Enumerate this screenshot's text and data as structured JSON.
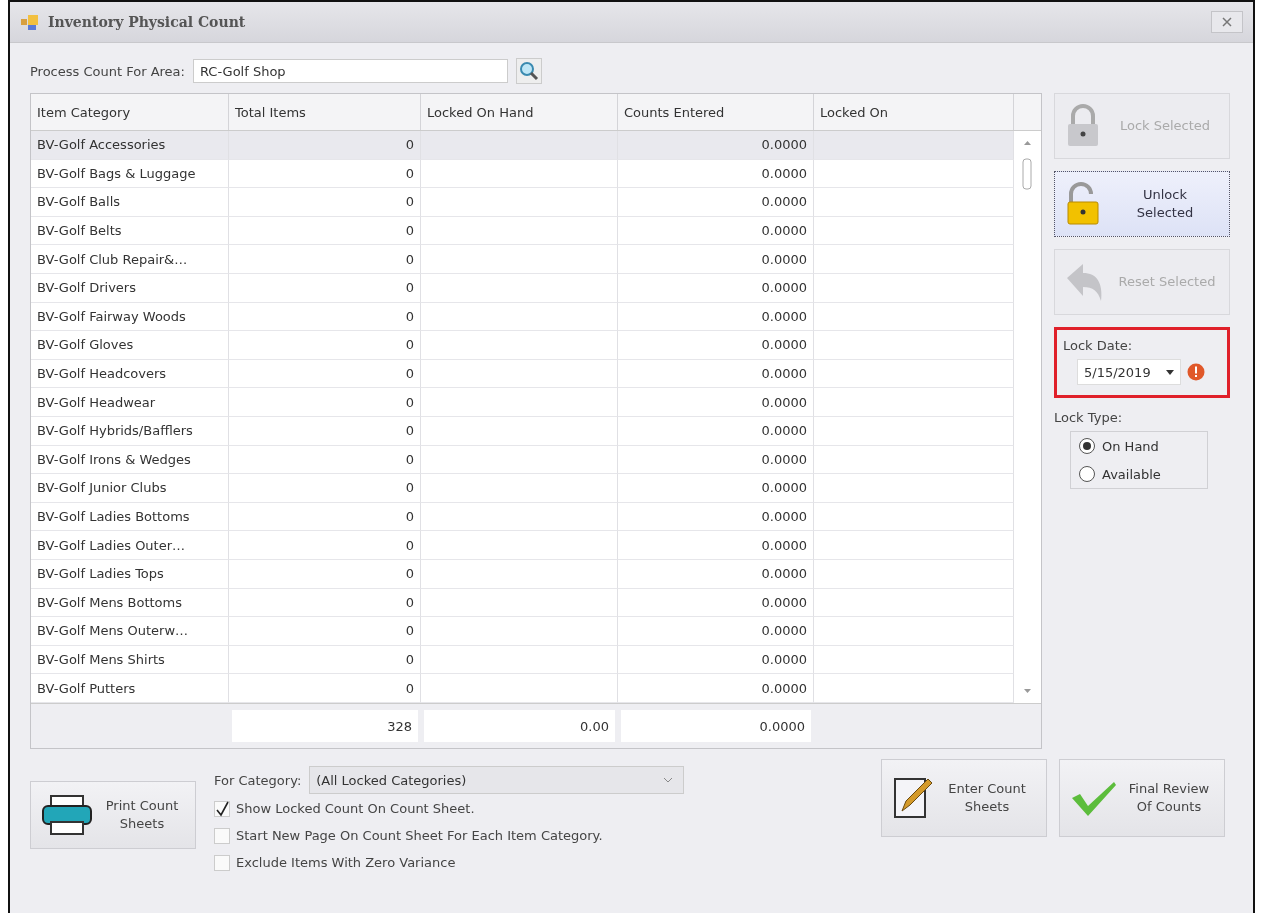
{
  "window": {
    "title": "Inventory Physical Count"
  },
  "area": {
    "label": "Process Count For Area:",
    "value": "RC-Golf Shop"
  },
  "grid": {
    "columns": [
      "Item Category",
      "Total Items",
      "Locked On Hand",
      "Counts Entered",
      "Locked On"
    ],
    "rows": [
      {
        "cells": [
          "BV-Golf Accessories",
          "0",
          "",
          "0.0000",
          ""
        ],
        "selected": true
      },
      {
        "cells": [
          "BV-Golf Bags & Luggage",
          "0",
          "",
          "0.0000",
          ""
        ],
        "selected": false
      },
      {
        "cells": [
          "BV-Golf Balls",
          "0",
          "",
          "0.0000",
          ""
        ],
        "selected": false
      },
      {
        "cells": [
          "BV-Golf Belts",
          "0",
          "",
          "0.0000",
          ""
        ],
        "selected": false
      },
      {
        "cells": [
          "BV-Golf Club Repair&…",
          "0",
          "",
          "0.0000",
          ""
        ],
        "selected": false
      },
      {
        "cells": [
          "BV-Golf Drivers",
          "0",
          "",
          "0.0000",
          ""
        ],
        "selected": false
      },
      {
        "cells": [
          "BV-Golf Fairway Woods",
          "0",
          "",
          "0.0000",
          ""
        ],
        "selected": false
      },
      {
        "cells": [
          "BV-Golf Gloves",
          "0",
          "",
          "0.0000",
          ""
        ],
        "selected": false
      },
      {
        "cells": [
          "BV-Golf Headcovers",
          "0",
          "",
          "0.0000",
          ""
        ],
        "selected": false
      },
      {
        "cells": [
          "BV-Golf Headwear",
          "0",
          "",
          "0.0000",
          ""
        ],
        "selected": false
      },
      {
        "cells": [
          "BV-Golf Hybrids/Bafflers",
          "0",
          "",
          "0.0000",
          ""
        ],
        "selected": false
      },
      {
        "cells": [
          "BV-Golf Irons & Wedges",
          "0",
          "",
          "0.0000",
          ""
        ],
        "selected": false
      },
      {
        "cells": [
          "BV-Golf Junior Clubs",
          "0",
          "",
          "0.0000",
          ""
        ],
        "selected": false
      },
      {
        "cells": [
          "BV-Golf Ladies Bottoms",
          "0",
          "",
          "0.0000",
          ""
        ],
        "selected": false
      },
      {
        "cells": [
          "BV-Golf Ladies Outer…",
          "0",
          "",
          "0.0000",
          ""
        ],
        "selected": false
      },
      {
        "cells": [
          "BV-Golf Ladies Tops",
          "0",
          "",
          "0.0000",
          ""
        ],
        "selected": false
      },
      {
        "cells": [
          "BV-Golf Mens Bottoms",
          "0",
          "",
          "0.0000",
          ""
        ],
        "selected": false
      },
      {
        "cells": [
          "BV-Golf Mens Outerw…",
          "0",
          "",
          "0.0000",
          ""
        ],
        "selected": false
      },
      {
        "cells": [
          "BV-Golf Mens Shirts",
          "0",
          "",
          "0.0000",
          ""
        ],
        "selected": false
      },
      {
        "cells": [
          "BV-Golf Putters",
          "0",
          "",
          "0.0000",
          ""
        ],
        "selected": false
      }
    ],
    "totals": {
      "total_items": "328",
      "locked_on_hand": "0.00",
      "counts_entered": "0.0000"
    }
  },
  "side_buttons": [
    {
      "kind": "lock",
      "label": "Lock Selected",
      "disabled": true,
      "focused": false
    },
    {
      "kind": "unlock",
      "label": "Unlock Selected",
      "disabled": false,
      "focused": true
    },
    {
      "kind": "reset",
      "label": "Reset Selected",
      "disabled": true,
      "focused": false
    }
  ],
  "lock_date": {
    "label": "Lock Date:",
    "value": "5/15/2019"
  },
  "lock_type": {
    "label": "Lock Type:",
    "options": [
      {
        "label": "On Hand",
        "selected": true
      },
      {
        "label": "Available",
        "selected": false
      }
    ]
  },
  "print_button": {
    "label": "Print Count Sheets"
  },
  "category": {
    "label": "For Category:",
    "value": "(All Locked Categories)"
  },
  "checkboxes": [
    {
      "label": "Show Locked Count On Count Sheet.",
      "checked": true
    },
    {
      "label": "Start New Page On Count Sheet For Each Item Category.",
      "checked": false
    },
    {
      "label": "Exclude Items With Zero Variance",
      "checked": false
    }
  ],
  "action_buttons": [
    {
      "kind": "enter",
      "label": "Enter Count Sheets"
    },
    {
      "kind": "final",
      "label": "Final Review Of Counts"
    }
  ]
}
